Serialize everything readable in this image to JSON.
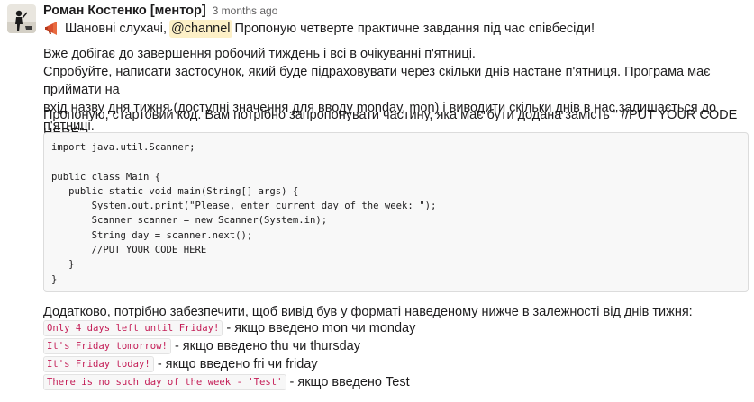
{
  "message": {
    "author": "Роман Костенко [ментор]",
    "timestamp": "3 months ago",
    "intro": {
      "icon": "megaphone-icon",
      "greeting": "Шановні слухачі,",
      "mention": "@channel",
      "rest": "Пропоную четверте практичне завдання під час співбесіди!"
    },
    "paragraph1": [
      "Вже добігає до завершення робочий тиждень і всі в очікуванні п'ятниці.",
      "Спробуйте, написати застосунок, який буде  підраховувати через скільки днів настане п'ятниця. Програма має приймати на",
      "вхід назву дня тижня (доступні значення для вводу monday, mon) і виводити скільки днів в нас залишається до п'ятниці."
    ],
    "paragraph2": "Пропоную, стартовий код. Вам потрібно запропонувати частину, яка має бути додана замість \" //PUT YOUR CODE HERE\"",
    "code_lines": [
      "import java.util.Scanner;",
      "",
      "public class Main {",
      "   public static void main(String[] args) {",
      "       System.out.print(\"Please, enter current day of the week: \");",
      "       Scanner scanner = new Scanner(System.in);",
      "       String day = scanner.next();",
      "       //PUT YOUR CODE HERE",
      "   }",
      "}"
    ],
    "paragraph3": "Додатково, потрібно забезпечити, щоб вивід був у форматі наведеному нижче в залежності від днів тижня:",
    "cases": [
      {
        "code": "Only 4 days left until Friday!",
        "text": "- якщо введено mon  чи monday"
      },
      {
        "code": "It's Friday tomorrow!",
        "text": "- якщо введено thu чи thursday"
      },
      {
        "code": "It's Friday today!",
        "text": "- якщо введено fri чи friday"
      },
      {
        "code": "There is no such day of the week - 'Test'",
        "text": "- якщо введено Test"
      }
    ]
  },
  "colors": {
    "mention_bg": "#fdf0c7",
    "inline_code_text": "#c41e57",
    "code_bg": "#f8f8f8",
    "timestamp": "#616061"
  }
}
